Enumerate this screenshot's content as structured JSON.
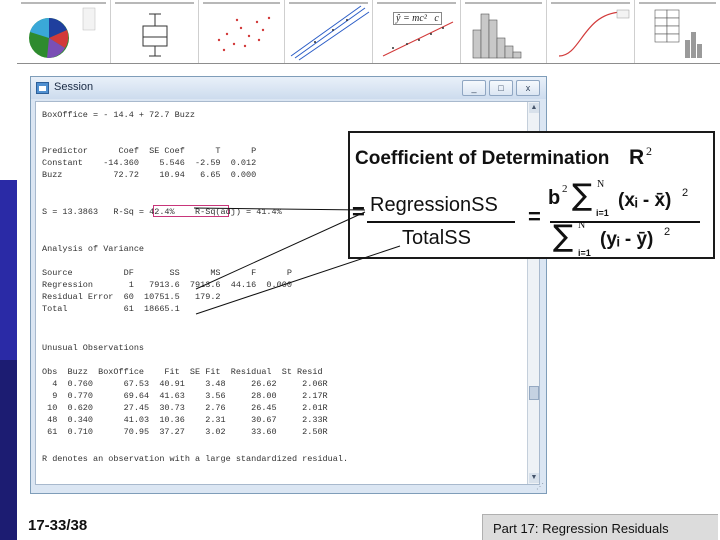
{
  "window": {
    "title": "Session",
    "buttons": {
      "minimize": "_",
      "maximize": "□",
      "close": "x"
    }
  },
  "session": {
    "lines": [
      "BoxOffice = - 14.4 + 72.7 Buzz",
      "",
      "Predictor      Coef  SE Coef      T      P",
      "Constant    -14.360    5.546  -2.59  0.012",
      "Buzz          72.72    10.94   6.65  0.000",
      "",
      "S = 13.3863   R-Sq = 42.4%    R-Sq(adj) = 41.4%",
      "",
      "Analysis of Variance",
      "",
      "Source          DF       SS      MS      F      P",
      "Regression       1   7913.6  7913.6  44.16  0.000",
      "Residual Error  60  10751.5   179.2",
      "Total           61  18665.1",
      "",
      "Unusual Observations",
      "",
      "Obs  Buzz  BoxOffice    Fit  SE Fit  Residual  St Resid",
      "  4  0.760      67.53  40.91    3.48     26.62     2.06R",
      "  9  0.770      69.64  41.63    3.56     28.00     2.17R",
      " 10  0.620      27.45  30.73    2.76     26.45     2.01R",
      " 48  0.340      41.03  10.36    2.31     30.67     2.33R",
      " 61  0.710      70.95  37.27    3.02     33.60     2.50R",
      "",
      "R denotes an observation with a large standardized residual."
    ]
  },
  "formula": {
    "title": "Coefficient of Determination",
    "title_symbol": "R",
    "title_power": "2",
    "numerator": "RegressionSS",
    "denominator": "TotalSS",
    "equals": "=",
    "coef": "b",
    "coef_power": "2",
    "sum_symbol": "∑",
    "sum_upper": "N",
    "sum_lower": "i=1",
    "num_term": "(xᵢ - x̄)",
    "den_term": "(yᵢ - ȳ)",
    "power": "2"
  },
  "thumbnail_equation": "ŷ = mc²   c",
  "footer": {
    "slide_number": "17-33/38",
    "caption": "Part 17: Regression Residuals"
  },
  "colors": {
    "band_blue": "#2a2aa6",
    "band_navy": "#1c1c72",
    "highlight": "#c8357a",
    "footer_bg": "#dcdcdc"
  }
}
